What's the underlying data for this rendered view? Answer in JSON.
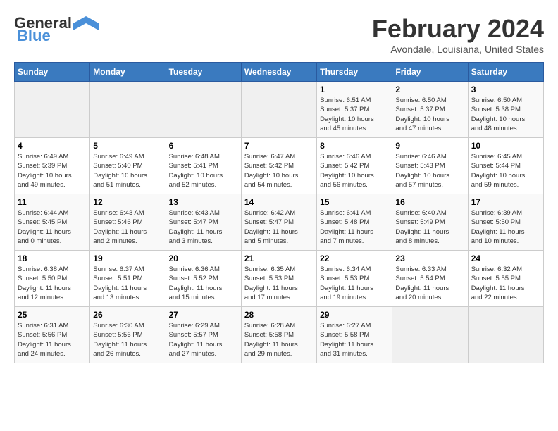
{
  "header": {
    "logo_general": "General",
    "logo_blue": "Blue",
    "month_year": "February 2024",
    "location": "Avondale, Louisiana, United States"
  },
  "days_of_week": [
    "Sunday",
    "Monday",
    "Tuesday",
    "Wednesday",
    "Thursday",
    "Friday",
    "Saturday"
  ],
  "weeks": [
    [
      {
        "day": "",
        "info": ""
      },
      {
        "day": "",
        "info": ""
      },
      {
        "day": "",
        "info": ""
      },
      {
        "day": "",
        "info": ""
      },
      {
        "day": "1",
        "info": "Sunrise: 6:51 AM\nSunset: 5:37 PM\nDaylight: 10 hours\nand 45 minutes."
      },
      {
        "day": "2",
        "info": "Sunrise: 6:50 AM\nSunset: 5:37 PM\nDaylight: 10 hours\nand 47 minutes."
      },
      {
        "day": "3",
        "info": "Sunrise: 6:50 AM\nSunset: 5:38 PM\nDaylight: 10 hours\nand 48 minutes."
      }
    ],
    [
      {
        "day": "4",
        "info": "Sunrise: 6:49 AM\nSunset: 5:39 PM\nDaylight: 10 hours\nand 49 minutes."
      },
      {
        "day": "5",
        "info": "Sunrise: 6:49 AM\nSunset: 5:40 PM\nDaylight: 10 hours\nand 51 minutes."
      },
      {
        "day": "6",
        "info": "Sunrise: 6:48 AM\nSunset: 5:41 PM\nDaylight: 10 hours\nand 52 minutes."
      },
      {
        "day": "7",
        "info": "Sunrise: 6:47 AM\nSunset: 5:42 PM\nDaylight: 10 hours\nand 54 minutes."
      },
      {
        "day": "8",
        "info": "Sunrise: 6:46 AM\nSunset: 5:42 PM\nDaylight: 10 hours\nand 56 minutes."
      },
      {
        "day": "9",
        "info": "Sunrise: 6:46 AM\nSunset: 5:43 PM\nDaylight: 10 hours\nand 57 minutes."
      },
      {
        "day": "10",
        "info": "Sunrise: 6:45 AM\nSunset: 5:44 PM\nDaylight: 10 hours\nand 59 minutes."
      }
    ],
    [
      {
        "day": "11",
        "info": "Sunrise: 6:44 AM\nSunset: 5:45 PM\nDaylight: 11 hours\nand 0 minutes."
      },
      {
        "day": "12",
        "info": "Sunrise: 6:43 AM\nSunset: 5:46 PM\nDaylight: 11 hours\nand 2 minutes."
      },
      {
        "day": "13",
        "info": "Sunrise: 6:43 AM\nSunset: 5:47 PM\nDaylight: 11 hours\nand 3 minutes."
      },
      {
        "day": "14",
        "info": "Sunrise: 6:42 AM\nSunset: 5:47 PM\nDaylight: 11 hours\nand 5 minutes."
      },
      {
        "day": "15",
        "info": "Sunrise: 6:41 AM\nSunset: 5:48 PM\nDaylight: 11 hours\nand 7 minutes."
      },
      {
        "day": "16",
        "info": "Sunrise: 6:40 AM\nSunset: 5:49 PM\nDaylight: 11 hours\nand 8 minutes."
      },
      {
        "day": "17",
        "info": "Sunrise: 6:39 AM\nSunset: 5:50 PM\nDaylight: 11 hours\nand 10 minutes."
      }
    ],
    [
      {
        "day": "18",
        "info": "Sunrise: 6:38 AM\nSunset: 5:50 PM\nDaylight: 11 hours\nand 12 minutes."
      },
      {
        "day": "19",
        "info": "Sunrise: 6:37 AM\nSunset: 5:51 PM\nDaylight: 11 hours\nand 13 minutes."
      },
      {
        "day": "20",
        "info": "Sunrise: 6:36 AM\nSunset: 5:52 PM\nDaylight: 11 hours\nand 15 minutes."
      },
      {
        "day": "21",
        "info": "Sunrise: 6:35 AM\nSunset: 5:53 PM\nDaylight: 11 hours\nand 17 minutes."
      },
      {
        "day": "22",
        "info": "Sunrise: 6:34 AM\nSunset: 5:53 PM\nDaylight: 11 hours\nand 19 minutes."
      },
      {
        "day": "23",
        "info": "Sunrise: 6:33 AM\nSunset: 5:54 PM\nDaylight: 11 hours\nand 20 minutes."
      },
      {
        "day": "24",
        "info": "Sunrise: 6:32 AM\nSunset: 5:55 PM\nDaylight: 11 hours\nand 22 minutes."
      }
    ],
    [
      {
        "day": "25",
        "info": "Sunrise: 6:31 AM\nSunset: 5:56 PM\nDaylight: 11 hours\nand 24 minutes."
      },
      {
        "day": "26",
        "info": "Sunrise: 6:30 AM\nSunset: 5:56 PM\nDaylight: 11 hours\nand 26 minutes."
      },
      {
        "day": "27",
        "info": "Sunrise: 6:29 AM\nSunset: 5:57 PM\nDaylight: 11 hours\nand 27 minutes."
      },
      {
        "day": "28",
        "info": "Sunrise: 6:28 AM\nSunset: 5:58 PM\nDaylight: 11 hours\nand 29 minutes."
      },
      {
        "day": "29",
        "info": "Sunrise: 6:27 AM\nSunset: 5:58 PM\nDaylight: 11 hours\nand 31 minutes."
      },
      {
        "day": "",
        "info": ""
      },
      {
        "day": "",
        "info": ""
      }
    ]
  ]
}
